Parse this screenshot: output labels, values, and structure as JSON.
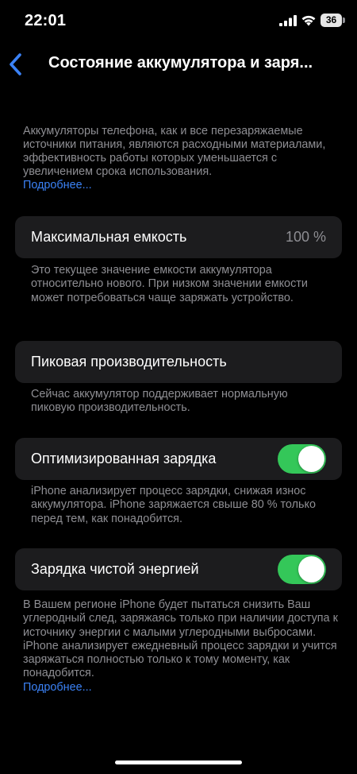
{
  "status_bar": {
    "time": "22:01",
    "battery_level": "36"
  },
  "nav": {
    "title": "Состояние аккумулятора и заря..."
  },
  "intro": {
    "text": "Аккумуляторы телефона, как и все перезаряжаемые источники питания, являются расходными материалами, эффективность работы которых уменьшается с увеличением срока использования.",
    "link": "Подробнее..."
  },
  "max_capacity": {
    "label": "Максимальная емкость",
    "value": "100 %",
    "footnote": "Это текущее значение емкости аккумулятора относительно нового. При низком значении емкости может потребоваться чаще заряжать устройство."
  },
  "peak_performance": {
    "label": "Пиковая производительность",
    "footnote": "Сейчас аккумулятор поддерживает нормальную пиковую производительность."
  },
  "optimized_charging": {
    "label": "Оптимизированная зарядка",
    "enabled": true,
    "footnote": "iPhone анализирует процесс зарядки, снижая износ аккумулятора. iPhone заряжается свыше 80 % только перед тем, как понадобится."
  },
  "clean_energy_charging": {
    "label": "Зарядка чистой энергией",
    "enabled": true,
    "footnote": "В Вашем регионе iPhone будет пытаться снизить Ваш углеродный след, заряжаясь только при наличии доступа к источнику энергии с малыми углеродными выбросами. iPhone анализирует ежедневный процесс зарядки и учится заряжаться полностью только к тому моменту, как понадобится.",
    "link": "Подробнее..."
  },
  "colors": {
    "background": "#000000",
    "card": "#1c1c1e",
    "secondary_text": "#8e8e93",
    "accent": "#3b82f6",
    "toggle_on": "#34c759"
  }
}
